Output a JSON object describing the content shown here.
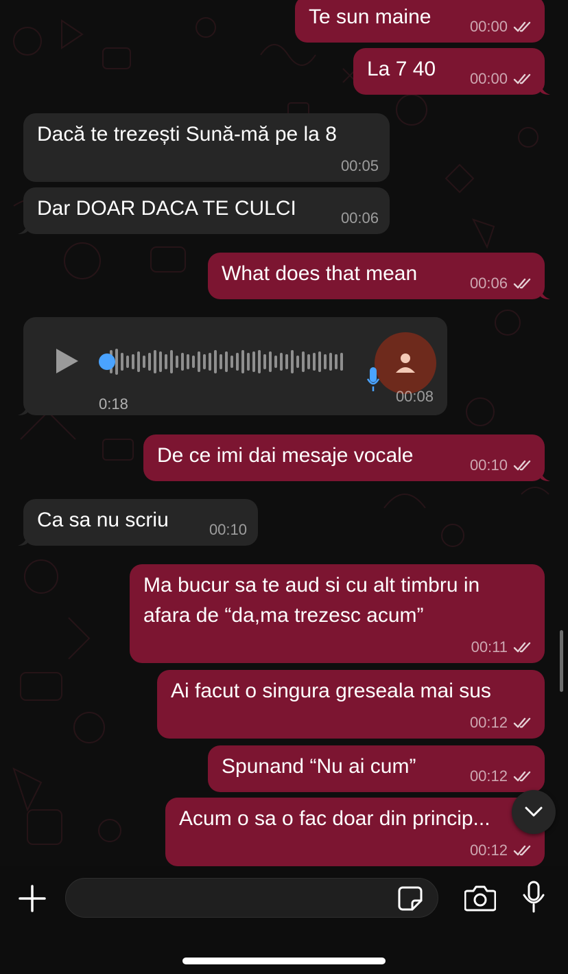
{
  "messages": [
    {
      "text": "Te sun maine",
      "time": "00:00",
      "direction": "outgoing",
      "status": "read"
    },
    {
      "text": "La 7 40",
      "time": "00:00",
      "direction": "outgoing",
      "status": "read"
    },
    {
      "text": "Dacă te trezești Sună-mă pe la 8",
      "time": "00:05",
      "direction": "incoming"
    },
    {
      "text": "Dar DOAR DACA TE CULCI",
      "time": "00:06",
      "direction": "incoming"
    },
    {
      "text": "What does that mean",
      "time": "00:06",
      "direction": "outgoing",
      "status": "read"
    },
    {
      "type": "voice",
      "duration": "0:18",
      "time": "00:08",
      "direction": "incoming"
    },
    {
      "text": "De ce imi dai mesaje vocale",
      "time": "00:10",
      "direction": "outgoing",
      "status": "read"
    },
    {
      "text": "Ca sa nu scriu",
      "time": "00:10",
      "direction": "incoming"
    },
    {
      "lines": [
        "Ma bucur sa te aud si cu alt timbru in",
        "afara de “da,ma trezesc acum”"
      ],
      "time": "00:11",
      "direction": "outgoing",
      "status": "read"
    },
    {
      "text": "Ai facut o singura greseala mai sus",
      "time": "00:12",
      "direction": "outgoing",
      "status": "read"
    },
    {
      "text": "Spunand “Nu ai cum”",
      "time": "00:12",
      "direction": "outgoing",
      "status": "read"
    },
    {
      "text": "Acum o sa o fac doar din princip...",
      "time": "00:12",
      "direction": "outgoing",
      "status": "read"
    }
  ],
  "composer": {
    "input_value": "",
    "icons": [
      "plus-icon",
      "sticker-icon",
      "camera-icon",
      "microphone-icon"
    ]
  },
  "colors": {
    "outgoing_bubble": "#7c1531",
    "incoming_bubble": "#262626",
    "background": "#0e0e0e",
    "voice_progress": "#4aa3ff",
    "avatar": "#6e2a1c"
  }
}
